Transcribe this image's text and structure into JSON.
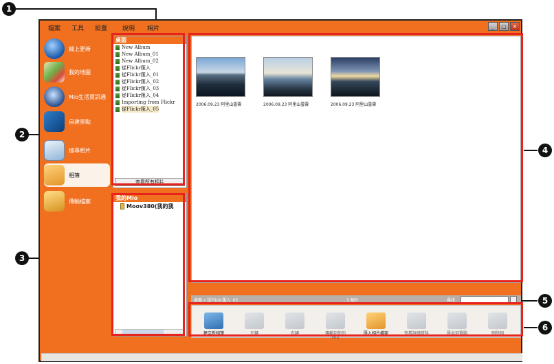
{
  "callouts": [
    "1",
    "2",
    "3",
    "4",
    "5",
    "6"
  ],
  "menu": [
    "檔案",
    "工具",
    "設置",
    "說明",
    "相片"
  ],
  "window_buttons": [
    "_",
    "□",
    "×"
  ],
  "sidebar": [
    {
      "label": "線上更新",
      "icon": "globe-icon"
    },
    {
      "label": "我的地圖",
      "icon": "map-icon"
    },
    {
      "label": "Mio生活資訊通",
      "icon": "info-globe-icon"
    },
    {
      "label": "自建景點",
      "icon": "poi-icon"
    },
    {
      "label": "搜尋相片",
      "icon": "photo-search-icon"
    },
    {
      "label": "相簿",
      "icon": "album-icon"
    },
    {
      "label": "傳輸檔案",
      "icon": "folder-icon"
    }
  ],
  "albums_panel": {
    "title": "桌面",
    "folders": [
      "New Album",
      "New Album_01",
      "New Album_02",
      "從Flickr匯入",
      "從Flickr匯入_01",
      "從Flickr匯入_02",
      "從Flickr匯入_03",
      "從Flickr匯入_04",
      "Importing from Flickr",
      "從Flickr匯入_05"
    ],
    "selected_index": 9,
    "view_all": "查看所有相片"
  },
  "mio_panel": {
    "title": "我的Mio",
    "device": "Moov380(我的我"
  },
  "photos": [
    {
      "caption": "2006.09.23 阿里山曇雲"
    },
    {
      "caption": "2006.09.23 阿里山曇雲"
    },
    {
      "caption": "2006.09.23 阿里山曇雲"
    }
  ],
  "status": {
    "breadcrumb": "桌面 » 從Flickr匯入_05",
    "count": "3 相片",
    "search_label": "尋找",
    "search_value": ""
  },
  "toolbar": [
    {
      "label": "建立新相簿",
      "icon": "new-album-icon",
      "enabled": true
    },
    {
      "label": "左轉",
      "icon": "rotate-left-icon",
      "enabled": false
    },
    {
      "label": "右轉",
      "icon": "rotate-right-icon",
      "enabled": false
    },
    {
      "label": "傳輸到你的\nMio",
      "icon": "send-to-mio-icon",
      "enabled": false
    },
    {
      "label": "匯入相片檔案",
      "icon": "import-photo-icon",
      "enabled": true
    },
    {
      "label": "查看詳細資料",
      "icon": "details-icon",
      "enabled": false
    },
    {
      "label": "匯出到電腦",
      "icon": "export-icon",
      "enabled": false
    },
    {
      "label": "刪除相",
      "icon": "delete-icon",
      "enabled": false
    }
  ],
  "colors": {
    "accent": "#f07020",
    "callout": "#e8231e"
  }
}
